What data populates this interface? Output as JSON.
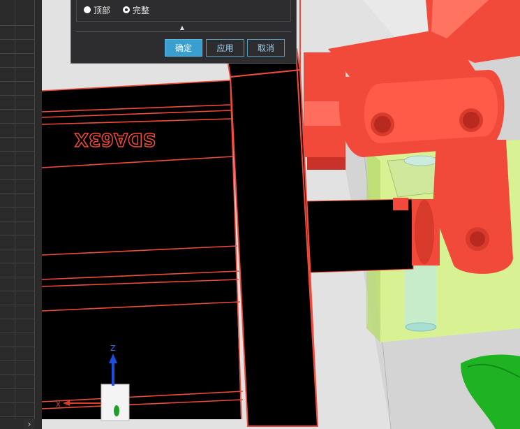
{
  "dialog": {
    "radio_top_label": "顶部",
    "radio_full_label": "完整",
    "selected": "完整",
    "ok_label": "确定",
    "apply_label": "应用",
    "cancel_label": "取消"
  },
  "model": {
    "engraved_text": "SDA63X"
  },
  "axis": {
    "z_label": "Z",
    "x_label": "X"
  },
  "colors": {
    "part_red": "#f24a3a",
    "highlight_green": "#d8f58c",
    "dialog_bg": "#2d2d2f",
    "ok_blue": "#3a9fce"
  },
  "icons": {
    "expand": "chevron-right-icon",
    "collapse": "caret-up-icon"
  }
}
